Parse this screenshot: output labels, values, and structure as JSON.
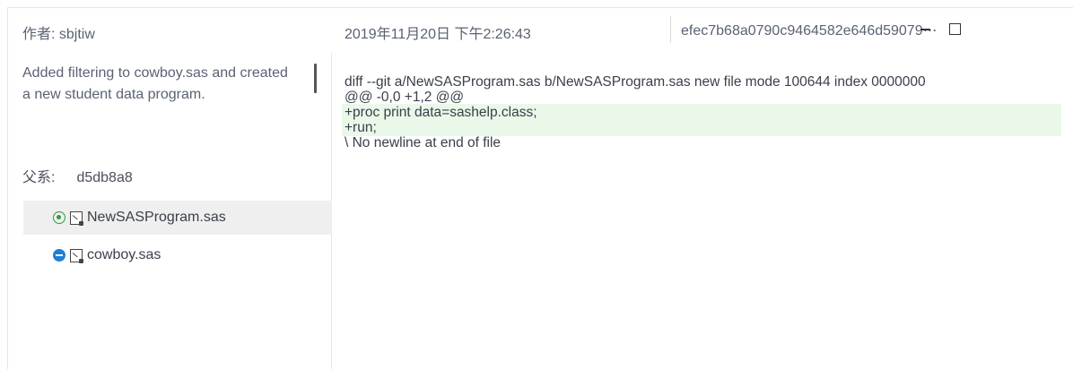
{
  "header": {
    "author": "作者: sbjtiw",
    "date": "2019年11月20日 下午2:26:43",
    "commit_hash": "efec7b68a0790c9464582e646d59079⋯"
  },
  "commit": {
    "message": "Added filtering to cowboy.sas and created a new student data program.",
    "parent_label": "父系:",
    "parent_hash": "d5db8a8"
  },
  "files": [
    {
      "name": "NewSASProgram.sas",
      "status": "added",
      "selected": true
    },
    {
      "name": "cowboy.sas",
      "status": "modified",
      "selected": false
    }
  ],
  "diff": {
    "lines": [
      "diff --git a/NewSASProgram.sas b/NewSASProgram.sas new file mode 100644 index 0000000",
      "@@ -0,0 +1,2 @@",
      "+proc print data=sashelp.class;",
      "+run;",
      "\\ No newline at end of file"
    ],
    "added_color": "#e9f8e9"
  },
  "icons": {
    "added": "added-status-icon",
    "modified": "modified-status-icon",
    "file": "sas-file-icon"
  }
}
